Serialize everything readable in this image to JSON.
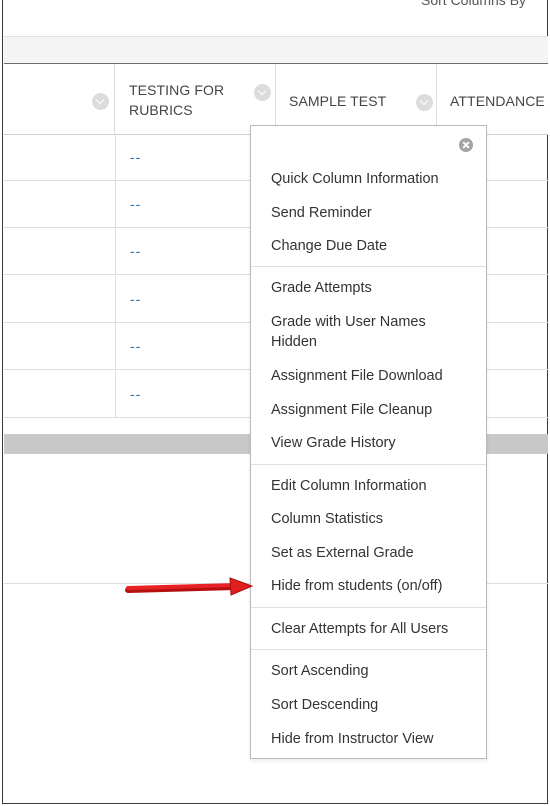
{
  "toolbar": {
    "sort_label": "Sort Columns By"
  },
  "columns": [
    {
      "label_line1": "TESTING FOR",
      "label_line2": "RUBRICS"
    },
    {
      "label": "SAMPLE TEST"
    },
    {
      "label": "ATTENDANCE"
    }
  ],
  "rows": [
    {
      "value": "--"
    },
    {
      "value": "--"
    },
    {
      "value": "--"
    },
    {
      "value": "--"
    },
    {
      "value": "--"
    },
    {
      "value": "--"
    }
  ],
  "menu": {
    "items": [
      "Quick Column Information",
      "Send Reminder",
      "Change Due Date",
      "Grade Attempts",
      "Grade with User Names",
      "Hidden",
      "Assignment File Download",
      "Assignment File Cleanup",
      "View Grade History",
      "Edit Column Information",
      "Column Statistics",
      "Set as External Grade",
      "Hide from students (on/off)",
      "Clear Attempts for All Users",
      "Sort Ascending",
      "Sort Descending",
      "Hide from Instructor View"
    ]
  },
  "colors": {
    "link": "#2a6dbd",
    "arrow": "#e02020",
    "band": "#c8c8c8"
  }
}
